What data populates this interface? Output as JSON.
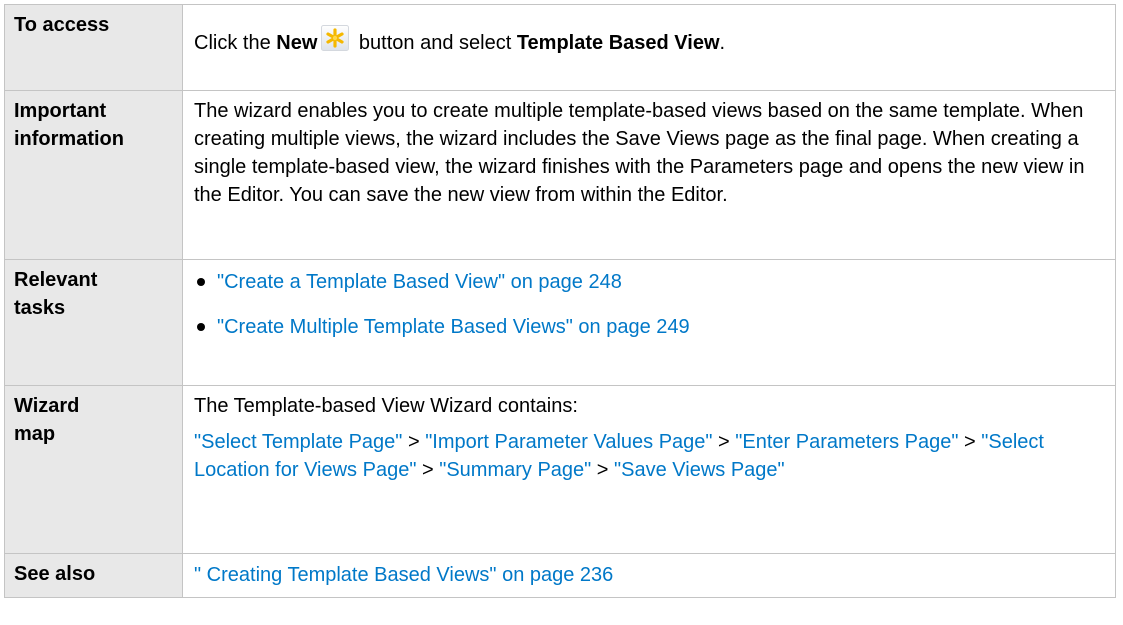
{
  "rows": {
    "access": {
      "label": "To access",
      "text_before": "Click the ",
      "new_word": "New",
      "text_middle": " button and select ",
      "template_view": "Template Based View",
      "text_after": ".",
      "icon": "new-star-icon"
    },
    "important": {
      "label_line1": "Important",
      "label_line2": "information",
      "text": "The wizard enables you to create multiple template-based views based on the same template. When creating multiple views, the wizard includes the Save Views page as the final page. When creating a single template-based view, the wizard finishes with the Parameters page and opens the new view in the Editor. You can save the new view from within the Editor."
    },
    "tasks": {
      "label_line1": "Relevant",
      "label_line2": "tasks",
      "items": [
        "\"Create a Template Based View\" on page 248",
        "\"Create Multiple Template Based Views\" on page 249"
      ]
    },
    "map": {
      "label_line1": "Wizard",
      "label_line2": "map",
      "intro": "The Template-based View Wizard contains:",
      "links": [
        "\"Select Template Page\"",
        "\"Import Parameter Values Page\"",
        "\"Enter Parameters Page\"",
        "\"Select Location for Views Page\"",
        "\"Summary Page\"",
        "\"Save Views Page\""
      ],
      "separator": " > "
    },
    "see_also": {
      "label": "See also",
      "link": "\" Creating Template Based Views\" on page 236"
    }
  },
  "colors": {
    "link": "#0078c8",
    "label_background": "#e8e8e8",
    "border": "#c4c4c4",
    "icon_star": "#f5b800"
  }
}
